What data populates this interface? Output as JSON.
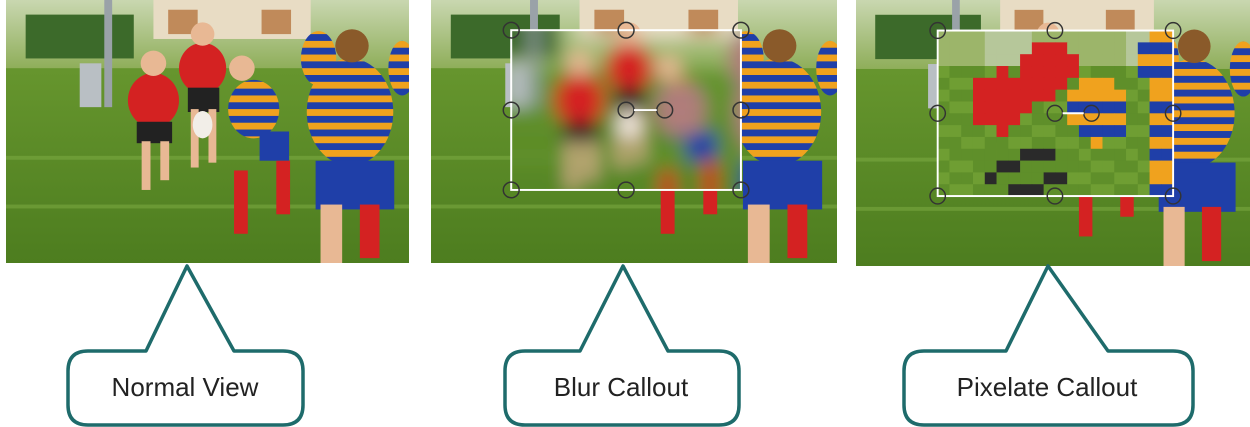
{
  "panels": [
    {
      "id": "normal",
      "label": "Normal View",
      "effect": "none"
    },
    {
      "id": "blur",
      "label": "Blur Callout",
      "effect": "blur"
    },
    {
      "id": "pixelate",
      "label": "Pixelate Callout",
      "effect": "pixelate"
    }
  ],
  "colors": {
    "bubble_outline": "#1e6b6b",
    "handle_outline": "#333333",
    "selection_border": "#ffffff",
    "grass": "#5f8f2a",
    "red_jersey": "#d42222",
    "blue_stripe": "#1f3fa8",
    "orange_stripe": "#f0a21e"
  }
}
